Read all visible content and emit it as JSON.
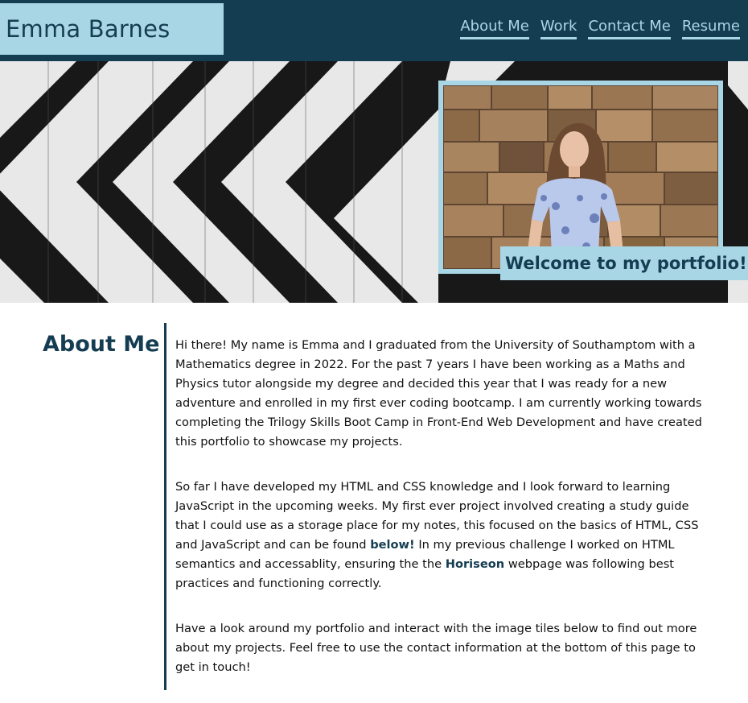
{
  "header": {
    "name": "Emma Barnes",
    "nav": [
      "About Me",
      "Work",
      "Contact Me",
      "Resume"
    ]
  },
  "hero": {
    "welcome": "Welcome to my portfolio!"
  },
  "about": {
    "title": "About Me",
    "p1": "Hi there! My name is Emma and I graduated from the University of Southamptom with a Mathematics degree in 2022. For the past 7 years I have been working as a Maths and Physics tutor alongside my degree and decided this year that I was ready for a new adventure and enrolled in my first ever coding bootcamp. I am currently working towards completing the Trilogy Skills Boot Camp in Front-End Web Development and have created this portfolio to showcase my projects.",
    "p2_a": "So far I have developed my HTML and CSS knowledge and I look forward to learning JavaScript in the upcoming weeks. My first ever project involved creating a study guide that I could use as a storage place for my notes, this focused on the basics of HTML, CSS and JavaScript and can be found ",
    "p2_link1": "below!",
    "p2_b": " In my previous challenge I worked on HTML semantics and accessablity, ensuring the the ",
    "p2_link2": "Horiseon",
    "p2_c": " webpage was following best practices and functioning correctly.",
    "p3": "Have a look around my portfolio and interact with the image tiles below to find out more about my projects. Feel free to use the contact information at the bottom of this page to get in touch!"
  },
  "colors": {
    "primary": "#143d52",
    "accent": "#a9d6e5"
  }
}
